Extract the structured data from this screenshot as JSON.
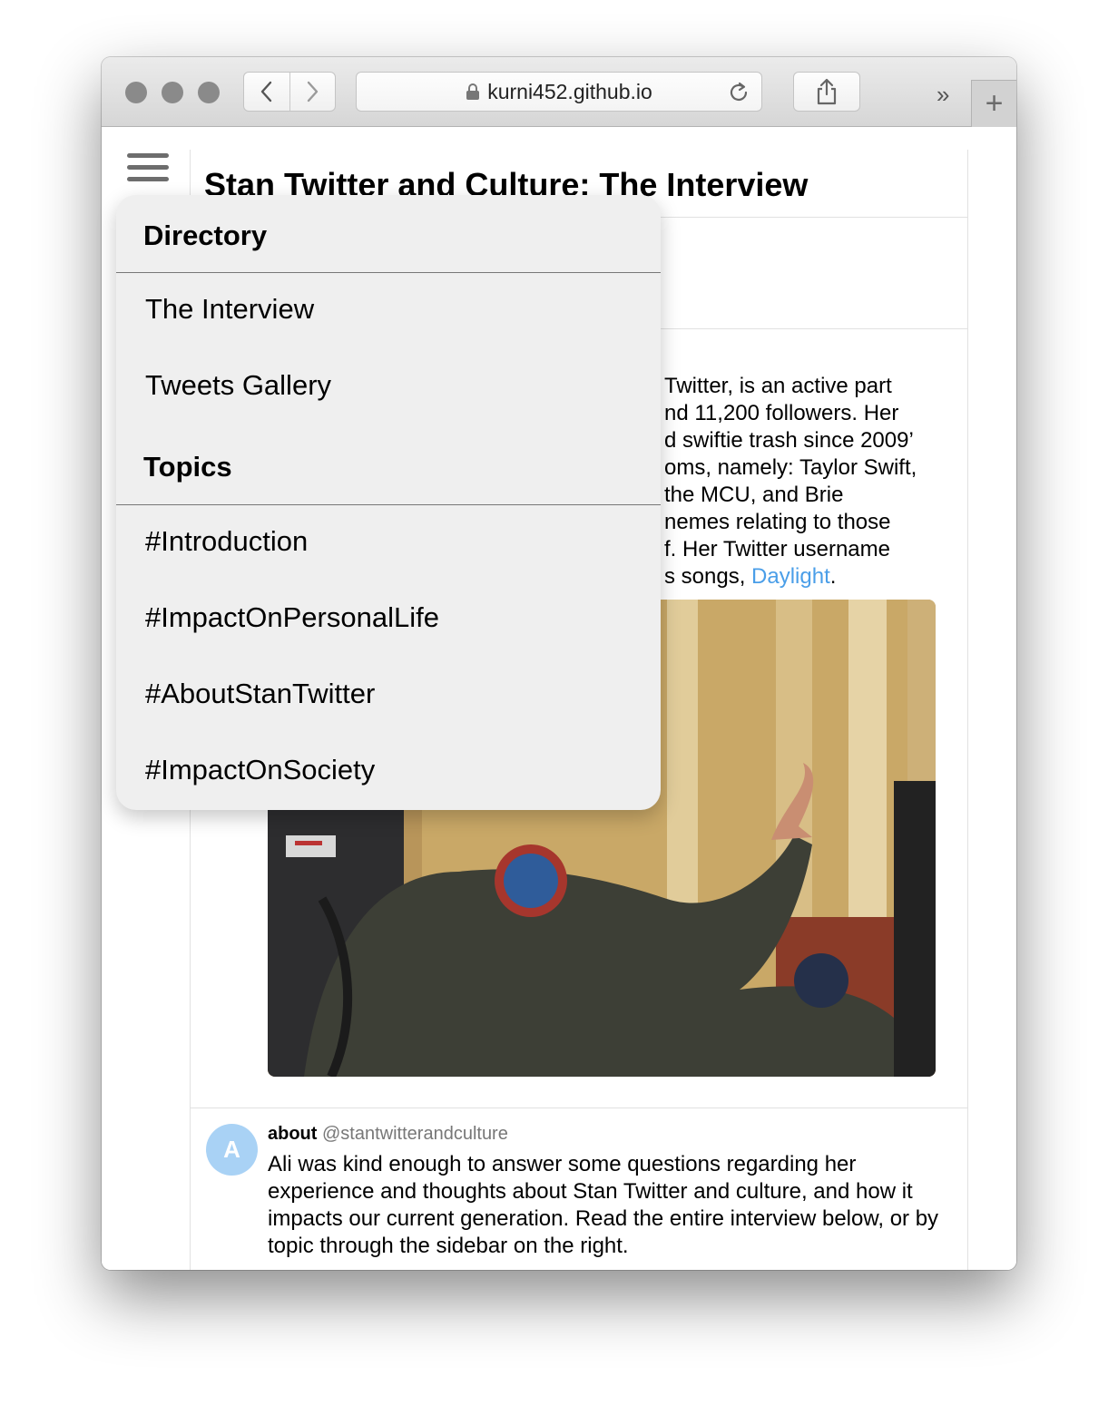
{
  "browser": {
    "url": "kurni452.github.io",
    "overflow_label": "»",
    "new_tab_label": "+"
  },
  "page": {
    "title": "Stan Twitter and Culture: The Interview",
    "intro_lines": [
      "Twitter, is an active part",
      "nd 11,200 followers. Her",
      "d swiftie trash since 2009’",
      "oms, namely: Taylor Swift,",
      "the MCU, and Brie",
      "nemes relating to those",
      "f. Her Twitter username",
      "s songs, "
    ],
    "intro_link": "Daylight",
    "intro_end": "."
  },
  "tweet": {
    "avatar_letter": "A",
    "name": "about",
    "handle": "@stantwitterandculture",
    "body": "Ali was kind enough to answer some questions regarding her experience and thoughts about Stan Twitter and culture, and how it impacts our current generation. Read the entire interview below, or by topic through the sidebar on the right."
  },
  "menu": {
    "directory_title": "Directory",
    "directory_items": [
      "The Interview",
      "Tweets Gallery"
    ],
    "topics_title": "Topics",
    "topic_items": [
      "#Introduction",
      "#ImpactOnPersonalLife",
      "#AboutStanTwitter",
      "#ImpactOnSociety"
    ]
  },
  "colors": {
    "link": "#4a9ee8",
    "avatar": "#a9d2f5",
    "menu_bg": "#efefef"
  }
}
